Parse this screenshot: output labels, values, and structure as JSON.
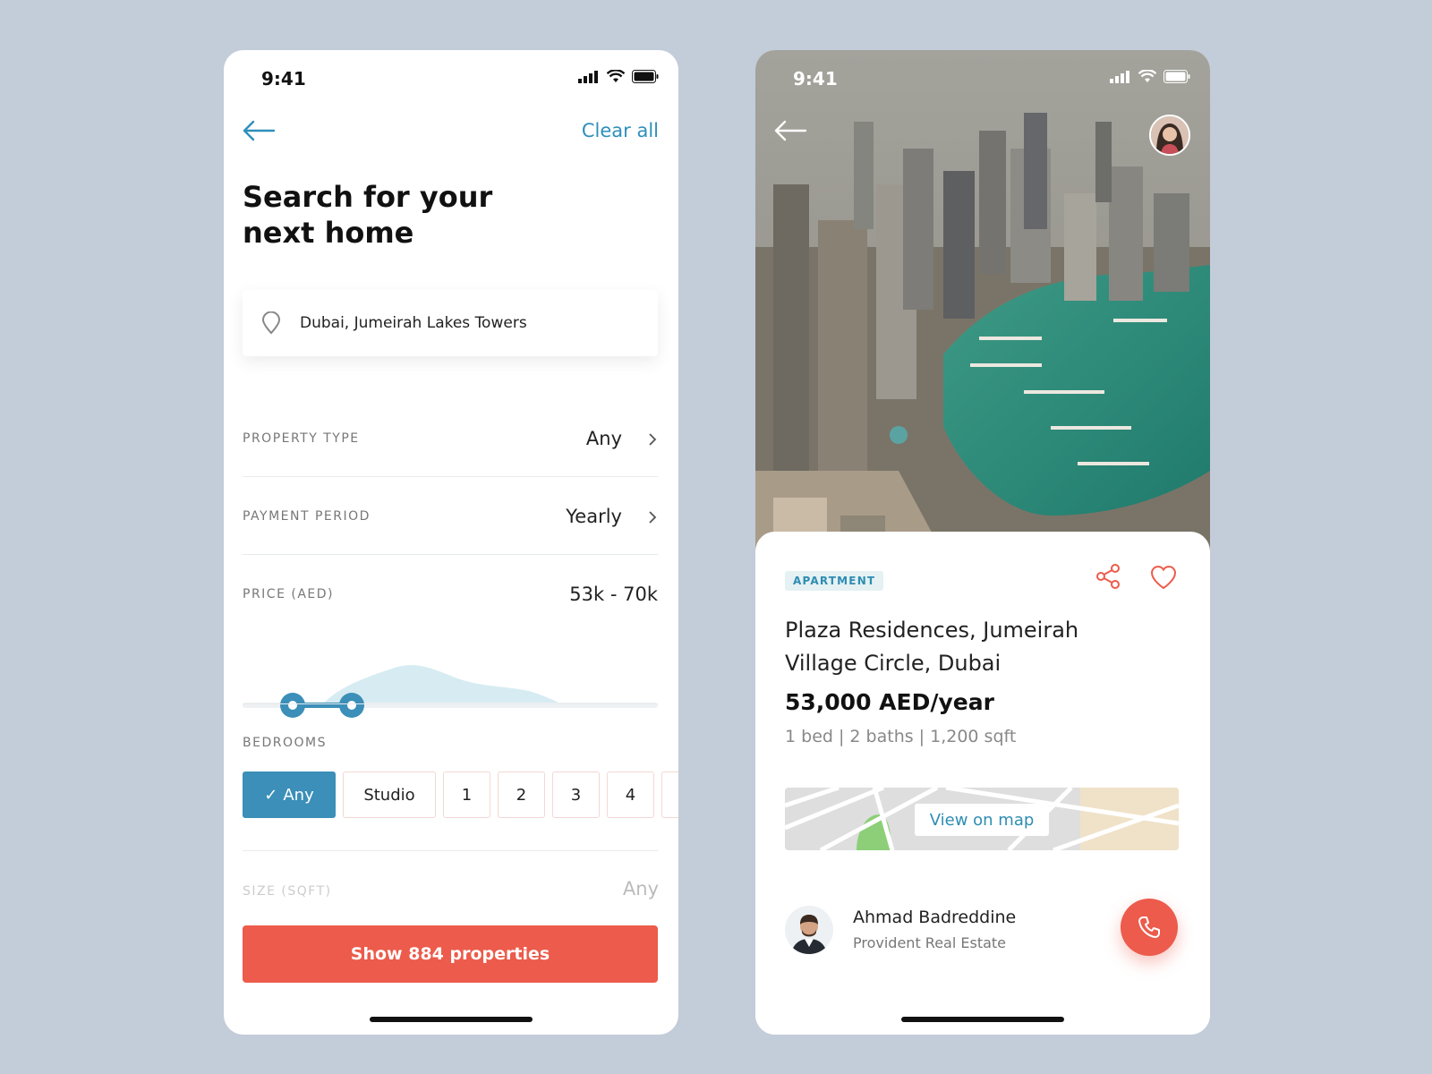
{
  "left_screen": {
    "status_time": "9:41",
    "header": {
      "clear_all": "Clear all"
    },
    "title": "Search for your next home",
    "search": {
      "value": "Dubai, Jumeirah Lakes Towers"
    },
    "filters": {
      "property_type": {
        "label": "PROPERTY TYPE",
        "value": "Any"
      },
      "payment_period": {
        "label": "PAYMENT PERIOD",
        "value": "Yearly"
      },
      "price": {
        "label": "PRICE (AED)",
        "value": "53k - 70k"
      }
    },
    "bedrooms": {
      "label": "BEDROOMS",
      "options": [
        "Any",
        "Studio",
        "1",
        "2",
        "3",
        "4"
      ],
      "selected": "Any"
    },
    "size": {
      "label": "SIZE (SQFT)",
      "value": "Any"
    },
    "show_button": "Show 884 properties"
  },
  "right_screen": {
    "status_time": "9:41",
    "badge": "APARTMENT",
    "title": "Plaza Residences, Jumeirah Village Circle, Dubai",
    "price": "53,000 AED/year",
    "details": "1 bed | 2 baths | 1,200 sqft",
    "map_button": "View on map",
    "agent": {
      "name": "Ahmad Badreddine",
      "company": "Provident Real Estate"
    }
  },
  "colors": {
    "accent": "#2f8fbb",
    "primary_button": "#ec5b4b",
    "background": "#c3ccd9"
  }
}
